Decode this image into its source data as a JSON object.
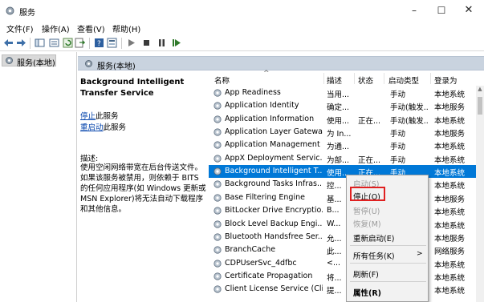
{
  "window": {
    "title": "服务",
    "min": "–",
    "max": "☐",
    "close": "✕"
  },
  "menu": [
    "文件(F)",
    "操作(A)",
    "查看(V)",
    "帮助(H)"
  ],
  "tree": {
    "selected_label": "服务(本地)"
  },
  "pane": {
    "header": "服务(本地)"
  },
  "description": {
    "service_title": "Background Intelligent Transfer Service",
    "stop_link": "停止",
    "stop_suffix": "此服务",
    "restart_link": "重启动",
    "restart_suffix": "此服务",
    "label": "描述:",
    "text": "使用空闲网络带宽在后台传送文件。如果该服务被禁用，则依赖于 BITS 的任何应用程序(如 Windows 更新或 MSN Explorer)将无法自动下载程序和其他信息。"
  },
  "columns": {
    "name": "名称",
    "desc": "描述",
    "status": "状态",
    "startup": "启动类型",
    "logon": "登录为",
    "sort_indicator": "^"
  },
  "rows": [
    {
      "name": "App Readiness",
      "desc": "当用...",
      "status": "",
      "startup": "手动",
      "logon": "本地系统"
    },
    {
      "name": "Application Identity",
      "desc": "确定...",
      "status": "",
      "startup": "手动(触发...",
      "logon": "本地服务"
    },
    {
      "name": "Application Information",
      "desc": "使用...",
      "status": "正在...",
      "startup": "手动(触发...",
      "logon": "本地系统"
    },
    {
      "name": "Application Layer Gatewa...",
      "desc": "为 In...",
      "status": "",
      "startup": "手动",
      "logon": "本地服务"
    },
    {
      "name": "Application Management",
      "desc": "为通...",
      "status": "",
      "startup": "手动",
      "logon": "本地系统"
    },
    {
      "name": "AppX Deployment Servic...",
      "desc": "为部...",
      "status": "正在...",
      "startup": "手动",
      "logon": "本地系统"
    },
    {
      "name": "Background Intelligent T...",
      "desc": "使用...",
      "status": "正在...",
      "startup": "手动",
      "logon": "本地系统"
    },
    {
      "name": "Background Tasks Infras...",
      "desc": "控...",
      "status": "",
      "startup": "",
      "logon": "本地系统"
    },
    {
      "name": "Base Filtering Engine",
      "desc": "基...",
      "status": "",
      "startup": "",
      "logon": "本地服务"
    },
    {
      "name": "BitLocker Drive Encryptio...",
      "desc": "B...",
      "status": "",
      "startup": "",
      "logon": "本地系统"
    },
    {
      "name": "Block Level Backup Engi...",
      "desc": "W...",
      "status": "",
      "startup": "",
      "logon": "本地系统"
    },
    {
      "name": "Bluetooth Handsfree Ser...",
      "desc": "允...",
      "status": "",
      "startup": "",
      "logon": "本地服务"
    },
    {
      "name": "BranchCache",
      "desc": "此...",
      "status": "",
      "startup": "",
      "logon": "网络服务"
    },
    {
      "name": "CDPUserSvc_4dfbc",
      "desc": "<...",
      "status": "",
      "startup": "",
      "logon": "本地系统"
    },
    {
      "name": "Certificate Propagation",
      "desc": "将...",
      "status": "",
      "startup": "",
      "logon": "本地系统"
    },
    {
      "name": "Client License Service (Cli...",
      "desc": "提...",
      "status": "",
      "startup": "",
      "logon": "本地系统"
    }
  ],
  "context_menu": {
    "start": "启动(S)",
    "stop": "停止(O)",
    "pause": "暂停(U)",
    "resume": "恢复(M)",
    "restart": "重新启动(E)",
    "all_tasks": "所有任务(K)",
    "submenu_arrow": ">",
    "refresh": "刷新(F)",
    "properties": "属性(R)"
  }
}
